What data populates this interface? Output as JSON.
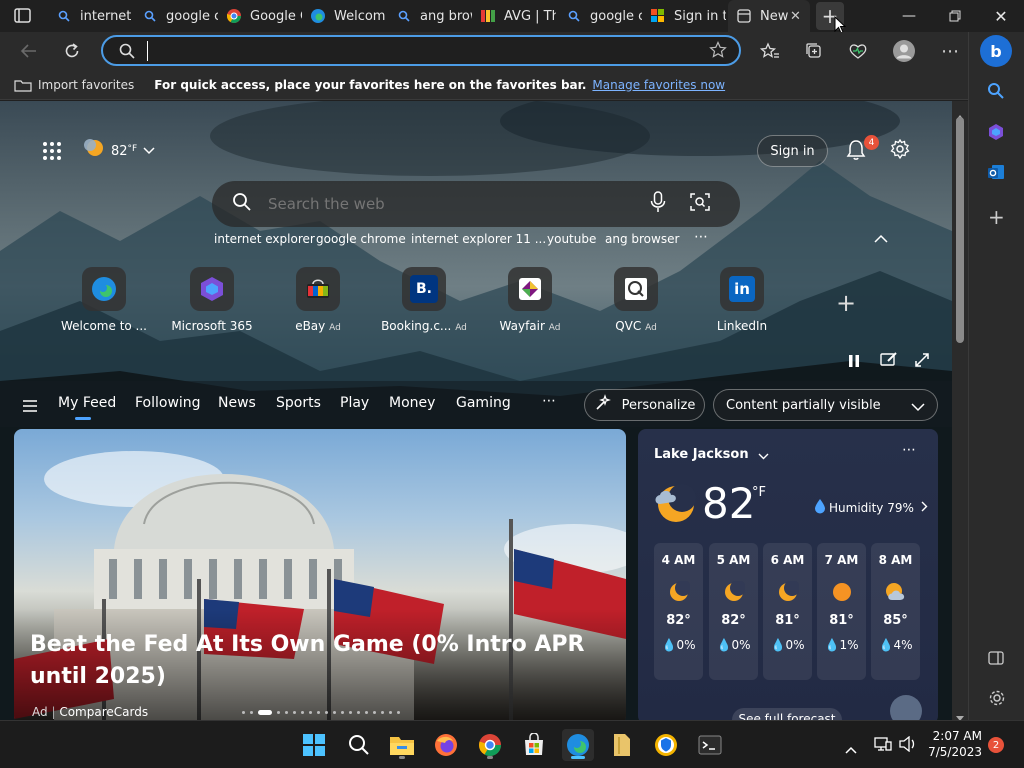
{
  "tabs": [
    {
      "label": "internet",
      "icon": "search-icon"
    },
    {
      "label": "google c",
      "icon": "search-icon"
    },
    {
      "label": "Google C",
      "icon": "chrome-icon"
    },
    {
      "label": "Welcome",
      "icon": "edge-icon"
    },
    {
      "label": "ang brow",
      "icon": "search-icon"
    },
    {
      "label": "AVG | Th",
      "icon": "avg-icon"
    },
    {
      "label": "google c",
      "icon": "search-icon"
    },
    {
      "label": "Sign in to",
      "icon": "microsoft-icon"
    },
    {
      "label": "New",
      "icon": "newtab-icon",
      "active": true
    }
  ],
  "address": {
    "value": "",
    "placeholder": ""
  },
  "favorites_bar": {
    "import_label": "Import favorites",
    "hint": "For quick access, place your favorites here on the favorites bar.",
    "manage_link": "Manage favorites now"
  },
  "page": {
    "weather_chip": "82",
    "weather_unit": "°F",
    "signin": "Sign in",
    "notifications": "4",
    "search_placeholder": "Search the web",
    "suggestions": [
      "internet explorer",
      "google chrome",
      "internet explorer 11 ...",
      "youtube",
      "ang browser"
    ],
    "quick_links": [
      {
        "label": "Welcome to ...",
        "ad": "",
        "icon": "edge-icon"
      },
      {
        "label": "Microsoft 365",
        "ad": "",
        "icon": "m365-icon"
      },
      {
        "label": "eBay",
        "ad": "Ad",
        "icon": "ebay-icon"
      },
      {
        "label": "Booking.c...",
        "ad": "Ad",
        "icon": "booking-icon"
      },
      {
        "label": "Wayfair",
        "ad": "Ad",
        "icon": "wayfair-icon"
      },
      {
        "label": "QVC",
        "ad": "Ad",
        "icon": "qvc-icon"
      },
      {
        "label": "LinkedIn",
        "ad": "",
        "icon": "linkedin-icon"
      }
    ],
    "feed_tabs": [
      "My Feed",
      "Following",
      "News",
      "Sports",
      "Play",
      "Money",
      "Gaming"
    ],
    "personalize": "Personalize",
    "content_visibility": "Content partially visible",
    "card": {
      "title": "Beat the Fed At Its Own Game (0% Intro APR until 2025)",
      "ad_label": "Ad",
      "source": "CompareCards"
    },
    "weather": {
      "location": "Lake Jackson",
      "temp": "82",
      "unit": "°F",
      "humidity": "Humidity 79%",
      "hours": [
        {
          "time": "4 AM",
          "temp": "82°",
          "precip": "0%",
          "icon": "moon-icon"
        },
        {
          "time": "5 AM",
          "temp": "82°",
          "precip": "0%",
          "icon": "moon-icon"
        },
        {
          "time": "6 AM",
          "temp": "81°",
          "precip": "0%",
          "icon": "moon-icon"
        },
        {
          "time": "7 AM",
          "temp": "81°",
          "precip": "1%",
          "icon": "sun-icon"
        },
        {
          "time": "8 AM",
          "temp": "85°",
          "precip": "4%",
          "icon": "partly-cloudy-icon"
        }
      ],
      "forecast_button": "See full forecast"
    }
  },
  "taskbar": {
    "time": "2:07 AM",
    "date": "7/5/2023",
    "notification_count": "2"
  }
}
